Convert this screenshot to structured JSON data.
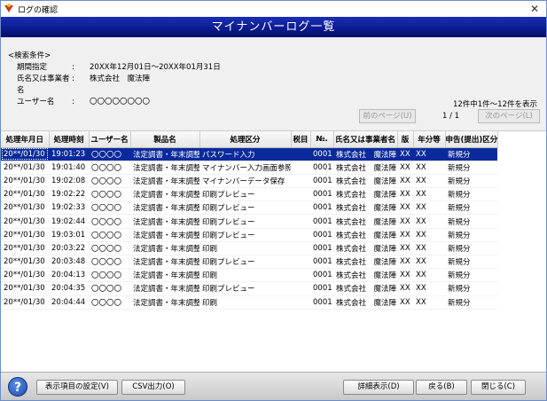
{
  "window": {
    "title": "ログの確認",
    "close": "✕"
  },
  "banner": {
    "title": "マイナンバーログ一覧"
  },
  "criteria": {
    "heading": "<検索条件>",
    "rows": [
      {
        "label": "期間指定",
        "colon": ":",
        "value": "20XX年12月01日～20XX年01月31日"
      },
      {
        "label": "氏名又は事業者名",
        "colon": ":",
        "value": "株式会社　魔法陣"
      },
      {
        "label": "ユーザー名",
        "colon": ":",
        "value": "〇〇〇〇〇〇〇〇"
      }
    ]
  },
  "pager": {
    "count_text": "12件中1件～12件を表示",
    "prev_label": "前のページ(U)",
    "page_info": "1 / 1",
    "next_label": "次のページ(L)"
  },
  "table": {
    "headers": [
      "処理年月日",
      "処理時刻",
      "ユーザー名",
      "製品名",
      "処理区分",
      "税目",
      "№.",
      "氏名又は事業者名",
      "版",
      "年分等",
      "申告(提出)区分"
    ],
    "rows": [
      [
        "20**/01/30",
        "19:01:23",
        "〇〇〇〇",
        "法定調書・年末調整",
        "パスワード入力",
        "",
        "0001",
        "株式会社　魔法陣",
        "XX",
        "XX",
        "新規分"
      ],
      [
        "20**/01/30",
        "19:01:40",
        "〇〇〇〇",
        "法定調書・年末調整",
        "マイナンバー入力画面参照",
        "",
        "0001",
        "株式会社　魔法陣",
        "XX",
        "XX",
        "新規分"
      ],
      [
        "20**/01/30",
        "19:02:08",
        "〇〇〇〇",
        "法定調書・年末調整",
        "マイナンバーデータ保存",
        "",
        "0001",
        "株式会社　魔法陣",
        "XX",
        "XX",
        "新規分"
      ],
      [
        "20**/01/30",
        "19:02:22",
        "〇〇〇〇",
        "法定調書・年末調整",
        "印刷プレビュー",
        "",
        "0001",
        "株式会社　魔法陣",
        "XX",
        "XX",
        "新規分"
      ],
      [
        "20**/01/30",
        "19:02:33",
        "〇〇〇〇",
        "法定調書・年末調整",
        "印刷プレビュー",
        "",
        "0001",
        "株式会社　魔法陣",
        "XX",
        "XX",
        "新規分"
      ],
      [
        "20**/01/30",
        "19:02:44",
        "〇〇〇〇",
        "法定調書・年末調整",
        "印刷プレビュー",
        "",
        "0001",
        "株式会社　魔法陣",
        "XX",
        "XX",
        "新規分"
      ],
      [
        "20**/01/30",
        "19:03:01",
        "〇〇〇〇",
        "法定調書・年末調整",
        "印刷プレビュー",
        "",
        "0001",
        "株式会社　魔法陣",
        "XX",
        "XX",
        "新規分"
      ],
      [
        "20**/01/30",
        "20:03:22",
        "〇〇〇〇",
        "法定調書・年末調整",
        "印刷",
        "",
        "0001",
        "株式会社　魔法陣",
        "XX",
        "XX",
        "新規分"
      ],
      [
        "20**/01/30",
        "20:03:48",
        "〇〇〇〇",
        "法定調書・年末調整",
        "印刷プレビュー",
        "",
        "0001",
        "株式会社　魔法陣",
        "XX",
        "XX",
        "新規分"
      ],
      [
        "20**/01/30",
        "20:04:13",
        "〇〇〇〇",
        "法定調書・年末調整",
        "印刷",
        "",
        "0001",
        "株式会社　魔法陣",
        "XX",
        "XX",
        "新規分"
      ],
      [
        "20**/01/30",
        "20:04:35",
        "〇〇〇〇",
        "法定調書・年末調整",
        "印刷プレビュー",
        "",
        "0001",
        "株式会社　魔法陣",
        "XX",
        "XX",
        "新規分"
      ],
      [
        "20**/01/30",
        "20:04:44",
        "〇〇〇〇",
        "法定調書・年末調整",
        "印刷",
        "",
        "0001",
        "株式会社　魔法陣",
        "XX",
        "XX",
        "新規分"
      ]
    ]
  },
  "footer": {
    "help": "?",
    "columns_button": "表示項目の設定(V)",
    "csv_button": "CSV出力(O)",
    "detail_button": "詳細表示(D)",
    "back_button": "戻る(B)",
    "close_button": "閉じる(C)"
  }
}
